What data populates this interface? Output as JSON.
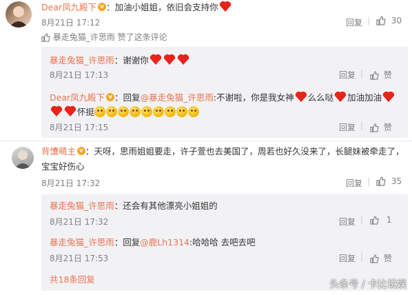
{
  "comments": [
    {
      "user": "Dear凤九殿下",
      "text": "：加油小姐姐，依旧会支持你",
      "time": "8月21日 17:12",
      "reply_label": "回复",
      "likes": "30",
      "liked_by": {
        "user": "暴走兔猫_许思雨",
        "text": " 赞了这条评论"
      },
      "replies": [
        {
          "user": "暴走兔猫_许思雨",
          "text": "：谢谢你",
          "time": "8月21日 17:13",
          "reply_label": "回复",
          "like_label": "赞"
        },
        {
          "user": "Dear凤九殿下",
          "prefix": "：回复",
          "mention": "@暴走兔猫_许思雨",
          "text": ":不谢啦，你是我女神",
          "text2": "么么哒",
          "text3": "加油加油",
          "text4": "怀挺",
          "time": "8月21日 17:15",
          "reply_label": "回复",
          "like_label": "赞"
        }
      ]
    },
    {
      "user": "背馕萌主",
      "text": "：天呀，思雨姐姐要走，许子萱也去美国了，周若也好久没来了，长腿妹被牵走了，",
      "text_line2": "宝宝好伤心",
      "time": "8月21日 17:32",
      "reply_label": "回复",
      "likes": "35",
      "replies": [
        {
          "user": "暴走兔猫_许思雨",
          "text": "：还会有其他漂亮小姐姐的",
          "time": "8月21日 17:32",
          "reply_label": "回复",
          "likes": "1"
        },
        {
          "user": "暴走兔猫_许思雨",
          "prefix": "：回复",
          "mention": "@鹿Lh1314",
          "text": ":哈哈哈 去吧去吧",
          "time": "8月21日 17:53",
          "reply_label": "回复",
          "like_label": "赞"
        }
      ],
      "more_replies": "共18条回复"
    }
  ],
  "watermark": "头条号 / 卡比说娱",
  "colors": {
    "username": "#eb7350",
    "timestamp": "#808080",
    "reply_bg": "#f2f2f5",
    "heart": "#e8231a"
  },
  "icons": [
    "heart-icon",
    "thumbs-up-icon",
    "verified-badge-icon",
    "emoji-icon"
  ]
}
